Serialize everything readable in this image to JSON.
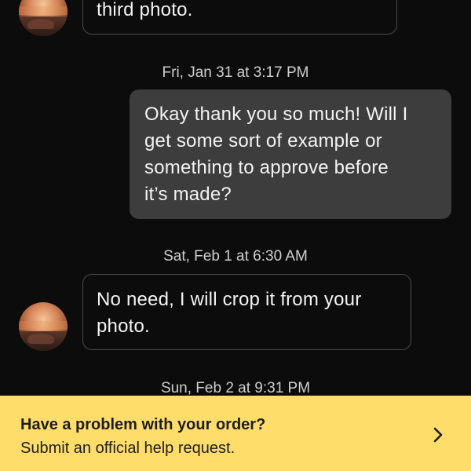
{
  "messages": [
    {
      "direction": "incoming",
      "text": "third photo."
    },
    {
      "direction": "outgoing",
      "timestamp": "Fri, Jan 31 at 3:17 PM",
      "lines": [
        "Okay thank you so much! Will I",
        "get some sort of example or",
        "something to approve before",
        "it’s made?"
      ]
    },
    {
      "direction": "incoming",
      "timestamp": "Sat, Feb 1 at 6:30 AM",
      "lines": [
        "No need, I will crop it from your",
        "photo."
      ]
    },
    {
      "timestamp": "Sun, Feb 2 at 9:31 PM"
    }
  ],
  "help_banner": {
    "title": "Have a problem with your order?",
    "subtitle": "Submit an official help request.",
    "icon": "chevron-right-icon",
    "background": "#fedd6b"
  },
  "colors": {
    "background": "#0c0c0c",
    "outgoing_bubble": "#3d3d3d",
    "incoming_border": "#4a4a4a"
  }
}
